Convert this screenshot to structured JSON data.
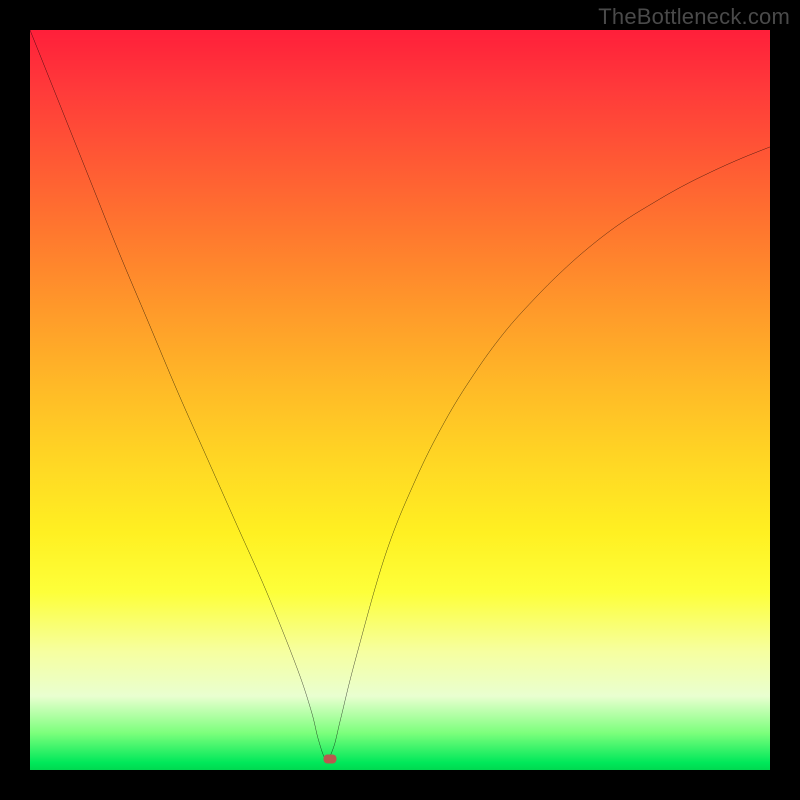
{
  "attribution": "TheBottleneck.com",
  "colors": {
    "background": "#000000",
    "curve_stroke": "#000000",
    "marker_fill": "#b9594e",
    "gradient_stops": [
      "#ff1f3a",
      "#ff7a2e",
      "#ffd624",
      "#fdff3a",
      "#00e85a"
    ]
  },
  "chart_data": {
    "type": "line",
    "title": "",
    "xlabel": "",
    "ylabel": "",
    "xlim": [
      0,
      100
    ],
    "ylim": [
      0,
      100
    ],
    "grid": false,
    "legend": false,
    "marker": {
      "x": 40.5,
      "y": 1.5
    },
    "series": [
      {
        "name": "bottleneck-curve",
        "x": [
          0,
          4,
          8,
          12,
          16,
          20,
          24,
          28,
          32,
          36,
          38,
          39,
          40,
          41,
          42,
          44,
          48,
          52,
          56,
          60,
          64,
          68,
          72,
          76,
          80,
          84,
          88,
          92,
          96,
          100
        ],
        "y": [
          100,
          90,
          80,
          70,
          60.5,
          51,
          42,
          33,
          24,
          14,
          8,
          4,
          1.5,
          3,
          7,
          15,
          29,
          39,
          47,
          53.5,
          59,
          63.5,
          67.5,
          71,
          74,
          76.5,
          78.8,
          80.8,
          82.6,
          84.2
        ]
      }
    ]
  }
}
